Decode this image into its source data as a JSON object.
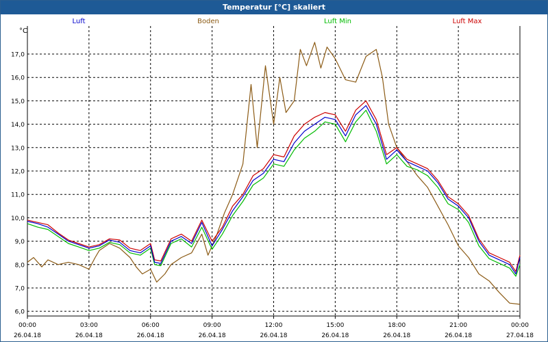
{
  "window": {
    "title": "Temperatur [°C] skaliert"
  },
  "colors": {
    "titlebar": "#1e5a96",
    "grid": "#000000",
    "axis": "#000000"
  },
  "chart_data": {
    "type": "line",
    "title": "Temperatur [°C] skaliert",
    "ylabel": "°C",
    "xlabel": "",
    "ylim": [
      5.8,
      18.2
    ],
    "xlim": [
      "26.04.18 00:00",
      "27.04.18 00:00"
    ],
    "yticks": [
      6.0,
      7.0,
      8.0,
      9.0,
      10.0,
      11.0,
      12.0,
      13.0,
      14.0,
      15.0,
      16.0,
      17.0
    ],
    "yticklabels": [
      "6,0",
      "7,0",
      "8,0",
      "9,0",
      "10,0",
      "11,0",
      "12,0",
      "13,0",
      "14,0",
      "15,0",
      "16,0",
      "17,0"
    ],
    "xticks": [
      {
        "time": "00:00",
        "date": "26.04.18",
        "hour": 0
      },
      {
        "time": "03:00",
        "date": "26.04.18",
        "hour": 3
      },
      {
        "time": "06:00",
        "date": "26.04.18",
        "hour": 6
      },
      {
        "time": "09:00",
        "date": "26.04.18",
        "hour": 9
      },
      {
        "time": "12:00",
        "date": "26.04.18",
        "hour": 12
      },
      {
        "time": "15:00",
        "date": "26.04.18",
        "hour": 15
      },
      {
        "time": "18:00",
        "date": "26.04.18",
        "hour": 18
      },
      {
        "time": "21:00",
        "date": "26.04.18",
        "hour": 21
      },
      {
        "time": "00:00",
        "date": "27.04.18",
        "hour": 24
      }
    ],
    "grid": true,
    "legend_position": "top",
    "series": [
      {
        "name": "Luft",
        "color": "#0000cc",
        "points": [
          [
            0,
            9.85
          ],
          [
            0.5,
            9.75
          ],
          [
            1.0,
            9.6
          ],
          [
            1.5,
            9.3
          ],
          [
            2.0,
            9.0
          ],
          [
            2.5,
            8.85
          ],
          [
            3.0,
            8.7
          ],
          [
            3.5,
            8.8
          ],
          [
            4.0,
            9.05
          ],
          [
            4.5,
            8.95
          ],
          [
            5.0,
            8.6
          ],
          [
            5.5,
            8.5
          ],
          [
            6.0,
            8.8
          ],
          [
            6.2,
            8.1
          ],
          [
            6.5,
            8.05
          ],
          [
            7.0,
            9.0
          ],
          [
            7.5,
            9.2
          ],
          [
            8.0,
            8.9
          ],
          [
            8.5,
            9.8
          ],
          [
            9.0,
            8.8
          ],
          [
            9.5,
            9.5
          ],
          [
            10.0,
            10.3
          ],
          [
            10.5,
            10.9
          ],
          [
            11.0,
            11.6
          ],
          [
            11.5,
            11.9
          ],
          [
            12.0,
            12.5
          ],
          [
            12.5,
            12.4
          ],
          [
            13.0,
            13.2
          ],
          [
            13.5,
            13.7
          ],
          [
            14.0,
            14.0
          ],
          [
            14.5,
            14.3
          ],
          [
            15.0,
            14.2
          ],
          [
            15.5,
            13.5
          ],
          [
            16.0,
            14.4
          ],
          [
            16.5,
            14.8
          ],
          [
            17.0,
            14.0
          ],
          [
            17.5,
            12.5
          ],
          [
            18.0,
            12.9
          ],
          [
            18.5,
            12.4
          ],
          [
            19.0,
            12.2
          ],
          [
            19.5,
            12.0
          ],
          [
            20.0,
            11.5
          ],
          [
            20.5,
            10.8
          ],
          [
            21.0,
            10.5
          ],
          [
            21.5,
            10.0
          ],
          [
            22.0,
            9.0
          ],
          [
            22.5,
            8.4
          ],
          [
            23.0,
            8.2
          ],
          [
            23.5,
            8.0
          ],
          [
            23.8,
            7.6
          ],
          [
            24.0,
            8.3
          ]
        ]
      },
      {
        "name": "Boden",
        "color": "#8b5a14",
        "points": [
          [
            0,
            8.1
          ],
          [
            0.3,
            8.3
          ],
          [
            0.7,
            7.9
          ],
          [
            1.0,
            8.2
          ],
          [
            1.5,
            8.0
          ],
          [
            2.0,
            8.1
          ],
          [
            2.5,
            8.0
          ],
          [
            3.0,
            7.8
          ],
          [
            3.3,
            8.3
          ],
          [
            3.5,
            8.6
          ],
          [
            4.0,
            8.9
          ],
          [
            4.5,
            8.7
          ],
          [
            5.0,
            8.3
          ],
          [
            5.3,
            7.9
          ],
          [
            5.6,
            7.6
          ],
          [
            6.0,
            7.8
          ],
          [
            6.3,
            7.25
          ],
          [
            6.7,
            7.6
          ],
          [
            7.0,
            8.0
          ],
          [
            7.5,
            8.3
          ],
          [
            8.0,
            8.5
          ],
          [
            8.5,
            9.3
          ],
          [
            8.8,
            8.4
          ],
          [
            9.2,
            9.2
          ],
          [
            9.6,
            10.2
          ],
          [
            10.0,
            11.0
          ],
          [
            10.5,
            12.3
          ],
          [
            10.9,
            15.7
          ],
          [
            11.2,
            13.0
          ],
          [
            11.6,
            16.5
          ],
          [
            12.0,
            14.0
          ],
          [
            12.3,
            16.0
          ],
          [
            12.6,
            14.5
          ],
          [
            13.0,
            15.0
          ],
          [
            13.3,
            17.2
          ],
          [
            13.6,
            16.5
          ],
          [
            14.0,
            17.5
          ],
          [
            14.3,
            16.4
          ],
          [
            14.6,
            17.3
          ],
          [
            15.0,
            16.8
          ],
          [
            15.5,
            15.9
          ],
          [
            16.0,
            15.8
          ],
          [
            16.5,
            16.9
          ],
          [
            17.0,
            17.2
          ],
          [
            17.3,
            16.0
          ],
          [
            17.6,
            14.0
          ],
          [
            18.0,
            13.0
          ],
          [
            18.5,
            12.4
          ],
          [
            19.0,
            11.8
          ],
          [
            19.5,
            11.3
          ],
          [
            20.0,
            10.5
          ],
          [
            20.5,
            9.7
          ],
          [
            21.0,
            8.8
          ],
          [
            21.5,
            8.3
          ],
          [
            22.0,
            7.6
          ],
          [
            22.5,
            7.3
          ],
          [
            23.0,
            6.8
          ],
          [
            23.5,
            6.35
          ],
          [
            24.0,
            6.3
          ]
        ]
      },
      {
        "name": "Luft Min",
        "color": "#00bb00",
        "points": [
          [
            0,
            9.75
          ],
          [
            0.5,
            9.6
          ],
          [
            1.0,
            9.5
          ],
          [
            1.5,
            9.2
          ],
          [
            2.0,
            8.9
          ],
          [
            2.5,
            8.75
          ],
          [
            3.0,
            8.6
          ],
          [
            3.5,
            8.7
          ],
          [
            4.0,
            8.95
          ],
          [
            4.5,
            8.85
          ],
          [
            5.0,
            8.5
          ],
          [
            5.5,
            8.4
          ],
          [
            6.0,
            8.7
          ],
          [
            6.2,
            8.0
          ],
          [
            6.5,
            7.95
          ],
          [
            7.0,
            8.9
          ],
          [
            7.5,
            9.1
          ],
          [
            8.0,
            8.75
          ],
          [
            8.5,
            9.6
          ],
          [
            9.0,
            8.65
          ],
          [
            9.5,
            9.3
          ],
          [
            10.0,
            10.1
          ],
          [
            10.5,
            10.7
          ],
          [
            11.0,
            11.4
          ],
          [
            11.5,
            11.7
          ],
          [
            12.0,
            12.3
          ],
          [
            12.5,
            12.2
          ],
          [
            13.0,
            12.9
          ],
          [
            13.5,
            13.4
          ],
          [
            14.0,
            13.7
          ],
          [
            14.5,
            14.1
          ],
          [
            15.0,
            14.0
          ],
          [
            15.5,
            13.25
          ],
          [
            16.0,
            14.1
          ],
          [
            16.5,
            14.6
          ],
          [
            17.0,
            13.7
          ],
          [
            17.5,
            12.3
          ],
          [
            18.0,
            12.7
          ],
          [
            18.5,
            12.2
          ],
          [
            19.0,
            12.05
          ],
          [
            19.5,
            11.8
          ],
          [
            20.0,
            11.3
          ],
          [
            20.5,
            10.6
          ],
          [
            21.0,
            10.35
          ],
          [
            21.5,
            9.8
          ],
          [
            22.0,
            8.8
          ],
          [
            22.5,
            8.25
          ],
          [
            23.0,
            8.05
          ],
          [
            23.5,
            7.85
          ],
          [
            23.8,
            7.5
          ],
          [
            24.0,
            8.0
          ]
        ]
      },
      {
        "name": "Luft Max",
        "color": "#cc0000",
        "points": [
          [
            0,
            9.9
          ],
          [
            0.5,
            9.8
          ],
          [
            1.0,
            9.7
          ],
          [
            1.5,
            9.35
          ],
          [
            2.0,
            9.05
          ],
          [
            2.5,
            8.9
          ],
          [
            3.0,
            8.75
          ],
          [
            3.5,
            8.85
          ],
          [
            4.0,
            9.1
          ],
          [
            4.5,
            9.05
          ],
          [
            5.0,
            8.7
          ],
          [
            5.5,
            8.6
          ],
          [
            6.0,
            8.9
          ],
          [
            6.2,
            8.2
          ],
          [
            6.5,
            8.15
          ],
          [
            7.0,
            9.1
          ],
          [
            7.5,
            9.3
          ],
          [
            8.0,
            9.0
          ],
          [
            8.5,
            9.9
          ],
          [
            9.0,
            9.0
          ],
          [
            9.5,
            9.6
          ],
          [
            10.0,
            10.5
          ],
          [
            10.5,
            11.0
          ],
          [
            11.0,
            11.8
          ],
          [
            11.5,
            12.1
          ],
          [
            12.0,
            12.7
          ],
          [
            12.5,
            12.6
          ],
          [
            13.0,
            13.5
          ],
          [
            13.5,
            14.0
          ],
          [
            14.0,
            14.3
          ],
          [
            14.5,
            14.5
          ],
          [
            15.0,
            14.4
          ],
          [
            15.5,
            13.7
          ],
          [
            16.0,
            14.6
          ],
          [
            16.5,
            15.0
          ],
          [
            17.0,
            14.2
          ],
          [
            17.5,
            12.7
          ],
          [
            18.0,
            13.0
          ],
          [
            18.5,
            12.5
          ],
          [
            19.0,
            12.3
          ],
          [
            19.5,
            12.1
          ],
          [
            20.0,
            11.6
          ],
          [
            20.5,
            10.9
          ],
          [
            21.0,
            10.6
          ],
          [
            21.5,
            10.1
          ],
          [
            22.0,
            9.1
          ],
          [
            22.5,
            8.5
          ],
          [
            23.0,
            8.3
          ],
          [
            23.5,
            8.1
          ],
          [
            23.8,
            7.7
          ],
          [
            24.0,
            8.4
          ]
        ]
      }
    ]
  }
}
